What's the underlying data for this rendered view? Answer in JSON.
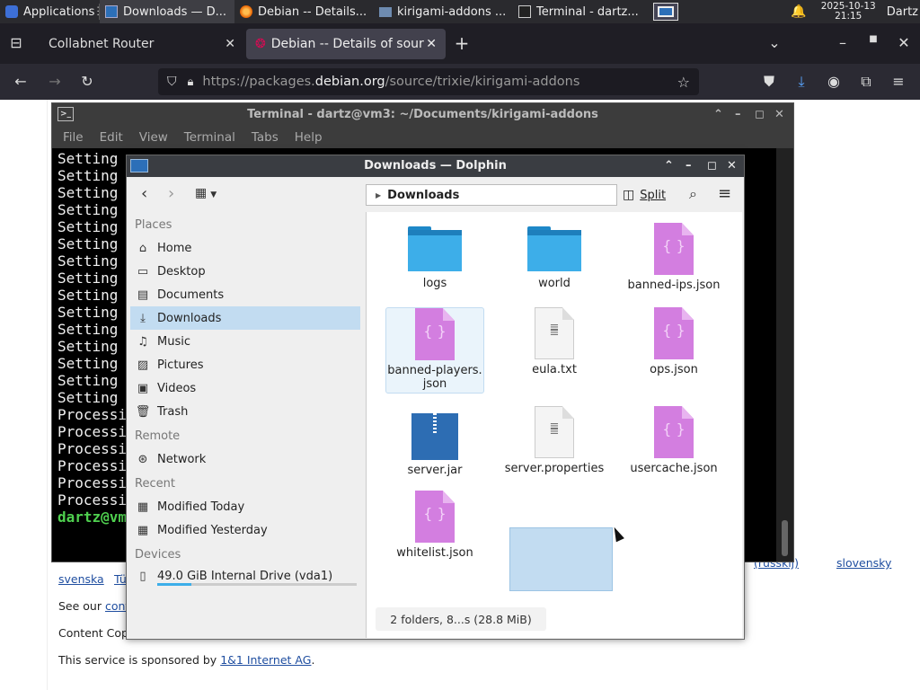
{
  "taskbar": {
    "items": [
      {
        "label": "Applications"
      },
      {
        "label": "Downloads — D..."
      },
      {
        "label": "Debian -- Details..."
      },
      {
        "label": "kirigami-addons ..."
      },
      {
        "label": "Terminal - dartz..."
      }
    ],
    "date": "2025-10-13",
    "time": "21:15",
    "user": "Dartz"
  },
  "browser": {
    "tabs": [
      {
        "label": "Collabnet Router"
      },
      {
        "label": "Debian -- Details of source"
      }
    ],
    "url_prefix": "https://packages.",
    "url_domain": "debian.org",
    "url_path": "/source/trixie/kirigami-addons"
  },
  "page": {
    "langs": [
      "slovensky",
      "svenska",
      "Tü"
    ],
    "lang_partial": "(russkij)",
    "see_our": "See our",
    "see_link": "cont",
    "content_copy": "Content Cop",
    "sponsor_text": "This service is sponsored by",
    "sponsor_link": "1&1 Internet AG",
    "sponsor_end": "."
  },
  "terminal": {
    "title": "Terminal - dartz@vm3: ~/Documents/kirigami-addons",
    "menu": [
      "File",
      "Edit",
      "View",
      "Terminal",
      "Tabs",
      "Help"
    ],
    "lines": [
      "Setting",
      "Setting",
      "Setting",
      "Setting",
      "Setting",
      "Setting",
      "Setting",
      "Setting",
      "Setting",
      "Setting",
      "Setting",
      "Setting",
      "Setting",
      "Setting",
      "Setting",
      "Processi",
      "Processi",
      "Processi",
      "Processi",
      "Processi",
      "Processi"
    ],
    "prompt": "dartz@vm"
  },
  "dolphin": {
    "title": "Downloads — Dolphin",
    "breadcrumb": "Downloads",
    "split_label": "Split",
    "places_header": "Places",
    "places": [
      {
        "label": "Home",
        "icon": "home-icon"
      },
      {
        "label": "Desktop",
        "icon": "desktop-icon"
      },
      {
        "label": "Documents",
        "icon": "documents-icon"
      },
      {
        "label": "Downloads",
        "icon": "downloads-icon",
        "selected": true
      },
      {
        "label": "Music",
        "icon": "music-icon"
      },
      {
        "label": "Pictures",
        "icon": "pictures-icon"
      },
      {
        "label": "Videos",
        "icon": "videos-icon"
      },
      {
        "label": "Trash",
        "icon": "trash-icon"
      }
    ],
    "remote_header": "Remote",
    "remote": [
      {
        "label": "Network",
        "icon": "network-icon"
      }
    ],
    "recent_header": "Recent",
    "recent": [
      {
        "label": "Modified Today",
        "icon": "calendar-icon"
      },
      {
        "label": "Modified Yesterday",
        "icon": "calendar-icon"
      }
    ],
    "devices_header": "Devices",
    "devices": [
      {
        "label": "49.0 GiB Internal Drive (vda1)",
        "icon": "drive-icon",
        "usage": 0.17
      }
    ],
    "files": [
      {
        "name": "logs",
        "type": "folder"
      },
      {
        "name": "world",
        "type": "folder"
      },
      {
        "name": "banned-ips.json",
        "type": "json"
      },
      {
        "name": "banned-players.\njson",
        "type": "json",
        "hovered": true
      },
      {
        "name": "eula.txt",
        "type": "text"
      },
      {
        "name": "ops.json",
        "type": "json"
      },
      {
        "name": "server.jar",
        "type": "jar"
      },
      {
        "name": "server.properties",
        "type": "text"
      },
      {
        "name": "usercache.json",
        "type": "json"
      },
      {
        "name": "whitelist.json",
        "type": "json"
      }
    ],
    "status": "2 folders, 8...s (28.8 MiB)"
  },
  "colors": {
    "selection": "#c2dcf1",
    "folder": "#3daee9",
    "json": "#d37ee0",
    "terminal_green": "#4fd04f"
  }
}
